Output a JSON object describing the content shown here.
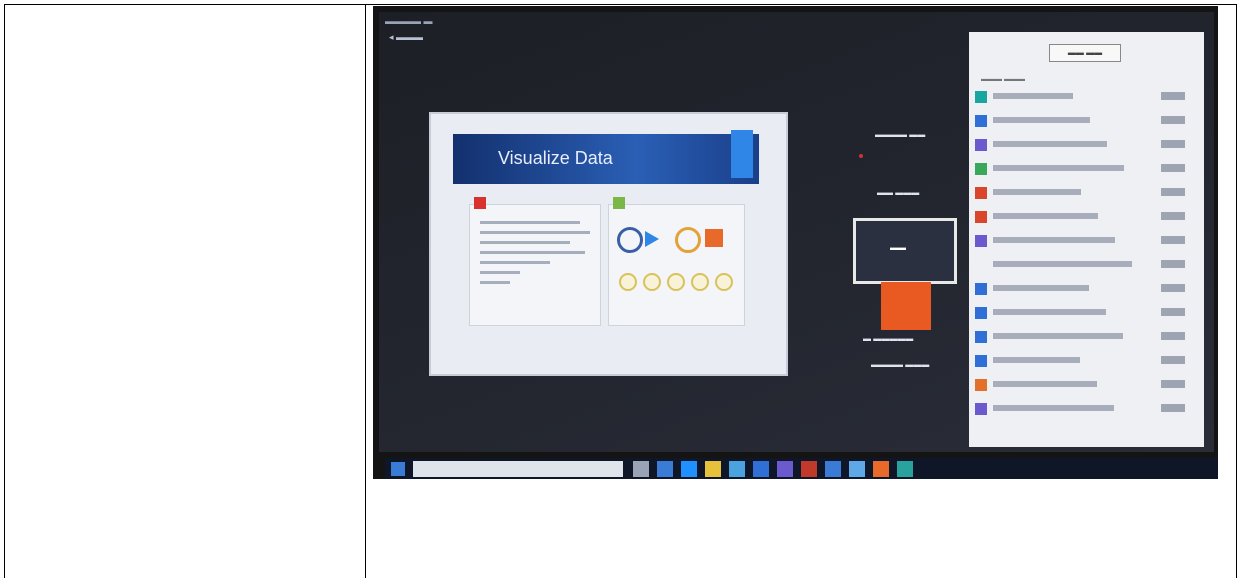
{
  "slide": {
    "title": "Visualize Data"
  },
  "colors": {
    "banner": "#1d3f86",
    "accent_orange": "#e85a22",
    "accent_blue": "#2f86e6",
    "accent_red": "#d9312b",
    "accent_green": "#7ab648",
    "taskbar": "#0f1627"
  },
  "side_icons": [
    "app-icon-teal",
    "app-icon-blue",
    "app-icon-purple",
    "app-icon-green",
    "app-icon-red",
    "app-icon-red",
    "app-icon-purple",
    "app-icon-none",
    "app-icon-blue",
    "app-icon-blue",
    "app-icon-blue",
    "app-icon-blue",
    "app-icon-orange",
    "app-icon-purple"
  ],
  "taskbar_icons": [
    "windows-start-icon",
    "search-box",
    "cortana-icon",
    "task-view-icon",
    "edge-icon",
    "folder-icon",
    "store-icon",
    "mail-icon",
    "app-icon",
    "app-icon",
    "app-icon",
    "app-icon",
    "powerpoint-icon",
    "app-icon"
  ]
}
